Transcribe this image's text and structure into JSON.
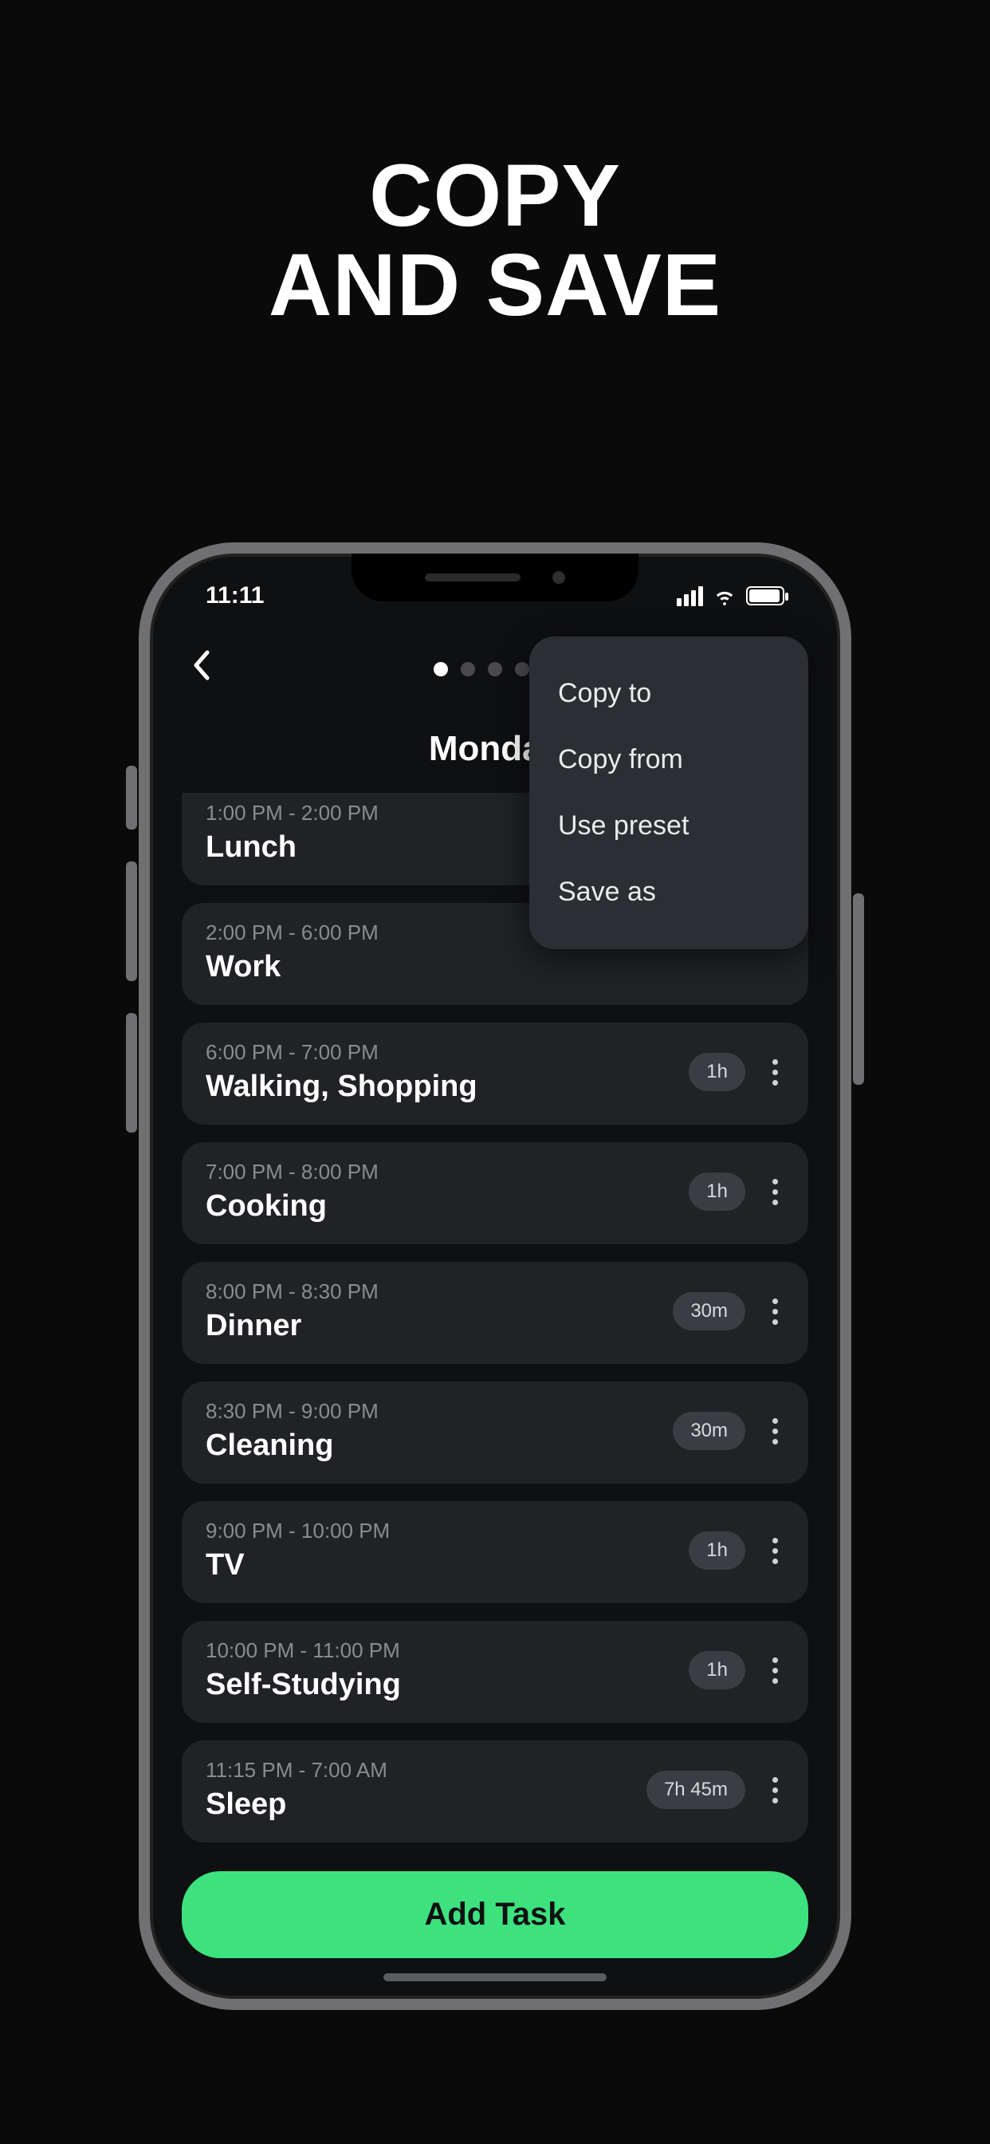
{
  "headline_line1": "COPY",
  "headline_line2": "AND SAVE",
  "status": {
    "time": "11:11"
  },
  "day_title": "Monday",
  "page_dots": {
    "count": 5,
    "active": 0
  },
  "popover": {
    "items": [
      {
        "label": "Copy to"
      },
      {
        "label": "Copy from"
      },
      {
        "label": "Use preset"
      },
      {
        "label": "Save as"
      }
    ]
  },
  "tasks": [
    {
      "time": "1:00 PM - 2:00 PM",
      "title": "Lunch",
      "duration": null,
      "cut_top": true
    },
    {
      "time": "2:00 PM - 6:00 PM",
      "title": "Work",
      "duration": null
    },
    {
      "time": "6:00 PM - 7:00 PM",
      "title": "Walking, Shopping",
      "duration": "1h"
    },
    {
      "time": "7:00 PM - 8:00 PM",
      "title": "Cooking",
      "duration": "1h"
    },
    {
      "time": "8:00 PM - 8:30 PM",
      "title": "Dinner",
      "duration": "30m"
    },
    {
      "time": "8:30 PM - 9:00 PM",
      "title": "Cleaning",
      "duration": "30m"
    },
    {
      "time": "9:00 PM - 10:00 PM",
      "title": "TV",
      "duration": "1h"
    },
    {
      "time": "10:00 PM - 11:00 PM",
      "title": "Self-Studying",
      "duration": "1h"
    },
    {
      "time": "11:15 PM - 7:00 AM",
      "title": "Sleep",
      "duration": "7h 45m"
    }
  ],
  "add_task_label": "Add Task"
}
